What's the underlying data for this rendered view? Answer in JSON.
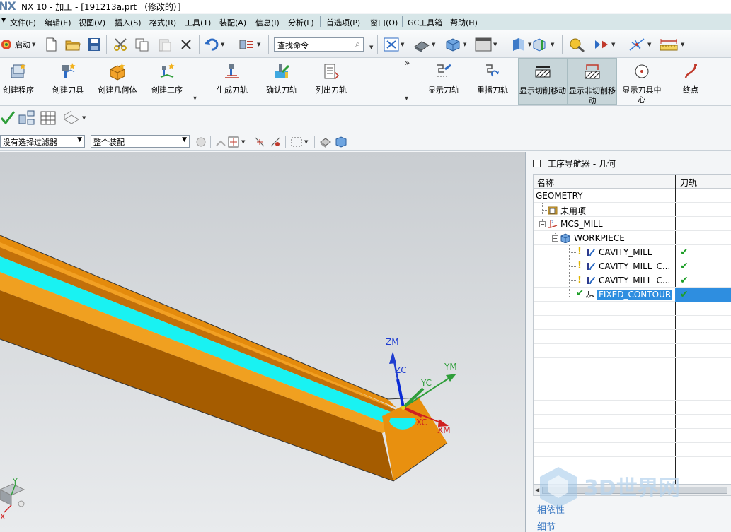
{
  "window": {
    "logo": "NX",
    "title": "NX 10 - 加工 - [191213a.prt （修改的）]"
  },
  "menu": [
    {
      "label": "文件(F)"
    },
    {
      "label": "编辑(E)"
    },
    {
      "label": "视图(V)"
    },
    {
      "label": "插入(S)"
    },
    {
      "label": "格式(R)"
    },
    {
      "label": "工具(T)"
    },
    {
      "label": "装配(A)"
    },
    {
      "label": "信息(I)"
    },
    {
      "label": "分析(L)"
    },
    {
      "label": "首选项(P)"
    },
    {
      "label": "窗口(O)"
    },
    {
      "label": "GC工具箱"
    },
    {
      "label": "帮助(H)"
    }
  ],
  "toolbar": {
    "start_label": "启动",
    "find_placeholder": "查找命令"
  },
  "ribbon": {
    "group1": [
      {
        "label": "创建程序",
        "icon": "create-program-icon"
      },
      {
        "label": "创建刀具",
        "icon": "create-tool-icon"
      },
      {
        "label": "创建几何体",
        "icon": "create-geometry-icon"
      },
      {
        "label": "创建工序",
        "icon": "create-operation-icon"
      }
    ],
    "group2": [
      {
        "label": "生成刀轨",
        "icon": "generate-toolpath-icon"
      },
      {
        "label": "确认刀轨",
        "icon": "verify-toolpath-icon"
      },
      {
        "label": "列出刀轨",
        "icon": "list-toolpath-icon"
      }
    ],
    "group3": [
      {
        "label": "显示刀轨",
        "icon": "show-toolpath-icon",
        "active": false
      },
      {
        "label": "重播刀轨",
        "icon": "replay-toolpath-icon",
        "active": false
      },
      {
        "label": "显示切削移动",
        "icon": "show-cut-moves-icon",
        "active": true
      },
      {
        "label": "显示非切削移动",
        "icon": "show-noncut-moves-icon",
        "active": true
      },
      {
        "label": "显示刀具中心",
        "icon": "show-tool-center-icon",
        "active": false
      },
      {
        "label": "终点",
        "icon": "endpoint-icon",
        "active": false
      }
    ]
  },
  "filter": {
    "type_filter": "没有选择过滤器",
    "scope": "整个装配"
  },
  "viewport": {
    "axes": {
      "zm": "ZM",
      "zc": "ZC",
      "ym": "YM",
      "yc": "YC",
      "xc": "XC",
      "xm": "XM"
    },
    "triad": {
      "y": "Y",
      "x": "X"
    },
    "colors": {
      "part": "#e8900f",
      "part_dark": "#a45d00",
      "cut_region": "#19f2f2"
    }
  },
  "navigator": {
    "header": "工序导航器 - 几何",
    "columns": {
      "name": "名称",
      "toolpath": "刀轨"
    },
    "rows": [
      {
        "name": "GEOMETRY",
        "level": 0,
        "icon": "",
        "status": ""
      },
      {
        "name": "未用项",
        "level": 1,
        "icon": "unused-folder-icon",
        "status": ""
      },
      {
        "name": "MCS_MILL",
        "level": 1,
        "icon": "mcs-icon",
        "status": ""
      },
      {
        "name": "WORKPIECE",
        "level": 2,
        "icon": "workpiece-icon",
        "status": ""
      },
      {
        "name": "CAVITY_MILL",
        "level": 3,
        "icon": "cavity-mill-icon",
        "status": "✔"
      },
      {
        "name": "CAVITY_MILL_C...",
        "level": 3,
        "icon": "cavity-mill-icon",
        "status": "✔"
      },
      {
        "name": "CAVITY_MILL_C...",
        "level": 3,
        "icon": "cavity-mill-icon",
        "status": "✔"
      },
      {
        "name": "FIXED_CONTOUR",
        "level": 3,
        "icon": "fixed-contour-icon",
        "status": "✔",
        "selected": true
      }
    ],
    "sections": [
      "相依性",
      "细节"
    ],
    "watermark": "3D世界网"
  }
}
